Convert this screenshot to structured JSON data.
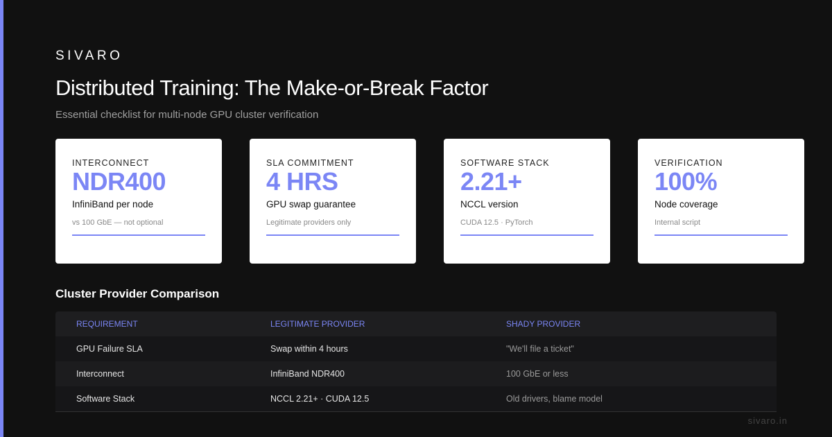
{
  "brand": "SIVARO",
  "title": "Distributed Training: The Make-or-Break Factor",
  "subtitle": "Essential checklist for multi-node GPU cluster verification",
  "accent_color": "#7b86f5",
  "cards": [
    {
      "label": "INTERCONNECT",
      "value": "NDR400",
      "desc": "InfiniBand per node",
      "note": "vs 100 GbE — not optional"
    },
    {
      "label": "SLA COMMITMENT",
      "value": "4 HRS",
      "desc": "GPU swap guarantee",
      "note": "Legitimate providers only"
    },
    {
      "label": "SOFTWARE STACK",
      "value": "2.21+",
      "desc": "NCCL version",
      "note": "CUDA 12.5 · PyTorch"
    },
    {
      "label": "VERIFICATION",
      "value": "100%",
      "desc": "Node coverage",
      "note": "Internal script"
    }
  ],
  "comparison": {
    "title": "Cluster Provider Comparison",
    "headers": [
      "REQUIREMENT",
      "LEGITIMATE PROVIDER",
      "SHADY PROVIDER"
    ],
    "rows": [
      [
        "GPU Failure SLA",
        "Swap within 4 hours",
        "\"We'll file a ticket\""
      ],
      [
        "Interconnect",
        "InfiniBand NDR400",
        "100 GbE or less"
      ],
      [
        "Software Stack",
        "NCCL 2.21+ · CUDA 12.5",
        "Old drivers, blame model"
      ]
    ]
  },
  "footer": "sivaro.in"
}
